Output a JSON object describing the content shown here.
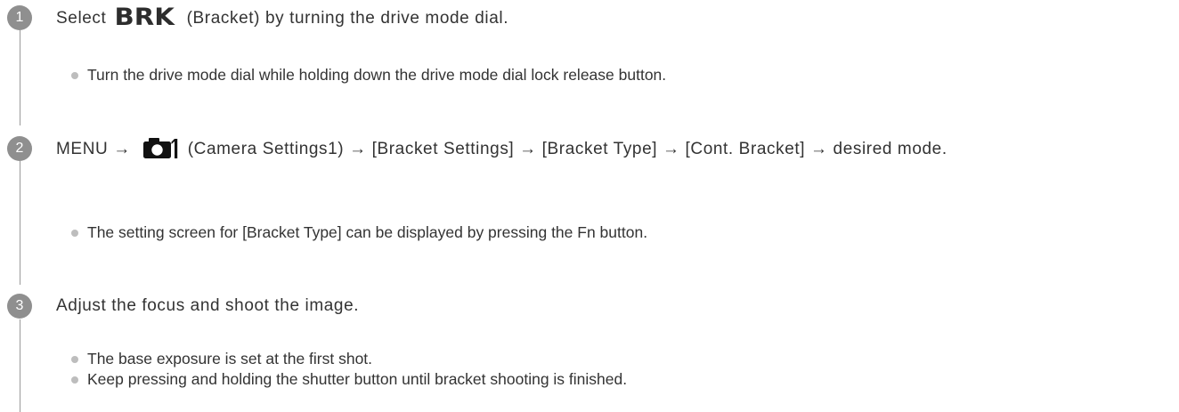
{
  "steps": [
    {
      "number": "1",
      "text_before": "Select",
      "icon_text": "BRK",
      "text_after": "(Bracket) by turning the drive mode dial.",
      "bullets": [
        "Turn the drive mode dial while holding down the drive mode dial lock release button."
      ]
    },
    {
      "number": "2",
      "text_before": "MENU →",
      "icon": "camera-settings-1-icon",
      "icon_text": "1",
      "text_after": "(Camera Settings1) → [Bracket Settings] → [Bracket Type] → [Cont. Bracket] → desired mode.",
      "bullets": [
        "The setting screen for [Bracket Type] can be displayed by pressing the Fn button."
      ]
    },
    {
      "number": "3",
      "text": "Adjust the focus and shoot the image.",
      "bullets": [
        "The base exposure is set at the first shot.",
        "Keep pressing and holding the shutter button until bracket shooting is finished."
      ]
    }
  ],
  "colors": {
    "text": "#333333",
    "step_circle": "#8f8f8f",
    "bullet_dot": "#bdbdbd",
    "connector_line": "#9a9a9a"
  }
}
